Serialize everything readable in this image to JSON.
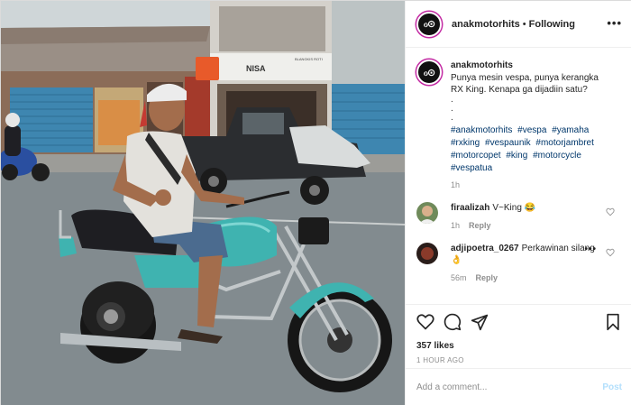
{
  "post": {
    "author": "anakmotorhits",
    "separator": "•",
    "follow_state": "Following",
    "more_icon": "more-horizontal-icon",
    "avatar_glyph": "ℴ⊙"
  },
  "photo": {
    "shop_sign": "NISA",
    "shop_sign_small": "BLANGKIS ROTI"
  },
  "caption": {
    "user": "anakmotorhits",
    "line1": "Punya mesin vespa, punya kerangka",
    "line2": "RX King. Kenapa ga dijadiin satu?",
    "dots": [
      ".",
      ".",
      "."
    ],
    "hashtags": [
      "#anakmotorhits",
      "#vespa",
      "#yamaha",
      "#rxking",
      "#vespaunik",
      "#motorjambret",
      "#motorcopet",
      "#king",
      "#motorcycle",
      "#vespatua"
    ],
    "time": "1h"
  },
  "comments": [
    {
      "user": "firaalizah",
      "text": "V~King 😂",
      "time": "1h",
      "reply_label": "Reply"
    },
    {
      "user": "adjipoetra_0267",
      "text": "Perkawinan silang👌",
      "time": "56m",
      "reply_label": "Reply"
    }
  ],
  "actions": {
    "like_icon": "heart-icon",
    "comment_icon": "comment-icon",
    "share_icon": "share-icon",
    "save_icon": "bookmark-icon"
  },
  "likes": "357 likes",
  "timestamp": "1 HOUR AGO",
  "add_comment": {
    "placeholder": "Add a comment...",
    "post_label": "Post"
  },
  "colors": {
    "link": "#00376b",
    "muted": "#8e8e8e",
    "post_button": "#b2dffc",
    "bike_teal": "#3fb3b0",
    "avatar_ring": "#c32aa3"
  }
}
